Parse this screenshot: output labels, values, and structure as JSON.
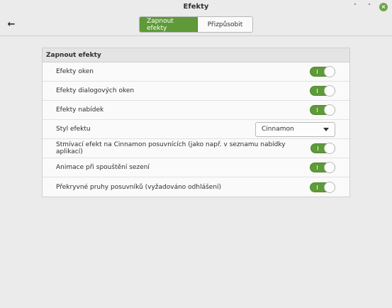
{
  "window": {
    "title": "Efekty",
    "minimize_glyph": "˅",
    "maximize_glyph": "˄",
    "close_glyph": "×"
  },
  "header": {
    "back_glyph": "←",
    "tabs": [
      {
        "label": "Zapnout efekty",
        "active": true
      },
      {
        "label": "Přizpůsobit",
        "active": false
      }
    ]
  },
  "panel": {
    "title": "Zapnout efekty",
    "rows": [
      {
        "label": "Efekty oken",
        "control": "switch",
        "value": true
      },
      {
        "label": "Efekty dialogových oken",
        "control": "switch",
        "value": true
      },
      {
        "label": "Efekty nabídek",
        "control": "switch",
        "value": true
      },
      {
        "label": "Styl efektu",
        "control": "combo",
        "value": "Cinnamon"
      },
      {
        "label": "Stmívací efekt na Cinnamon posuvnících (jako např. v seznamu nabídky aplikací)",
        "control": "switch",
        "value": true
      },
      {
        "label": "Animace při spouštění sezení",
        "control": "switch",
        "value": true
      },
      {
        "label": "Překryvné pruhy posuvníků (vyžadováno odhlášení)",
        "control": "switch",
        "value": true
      }
    ]
  },
  "colors": {
    "accent": "#5e9a38",
    "close_button": "#6fa34b"
  },
  "icons": {
    "back": "arrow-left-icon",
    "minimize": "chevron-down-icon",
    "maximize": "chevron-up-icon",
    "close": "close-icon",
    "combo": "caret-down-icon"
  }
}
